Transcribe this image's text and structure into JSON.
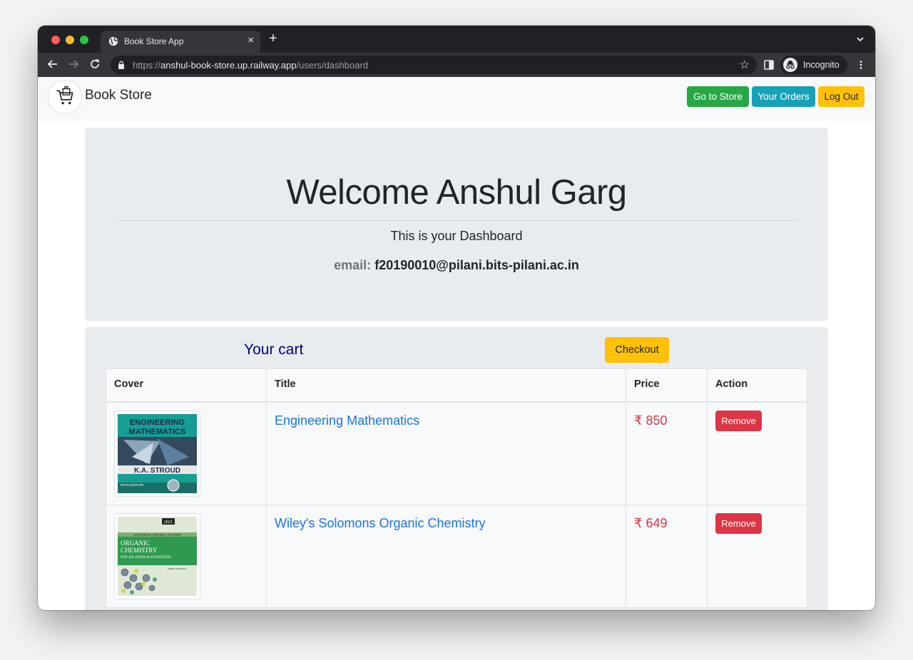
{
  "browser": {
    "tab_title": "Book Store App",
    "url_scheme": "https://",
    "url_host": "anshul-book-store.up.railway.app",
    "url_path": "/users/dashboard",
    "incognito_label": "Incognito"
  },
  "navbar": {
    "brand": "Book Store",
    "buttons": {
      "store": "Go to Store",
      "orders": "Your Orders",
      "logout": "Log Out"
    }
  },
  "dashboard": {
    "welcome_prefix": "Welcome",
    "user_name": "Anshul Garg",
    "subtitle": "This is your Dashboard",
    "email_label": "email:",
    "email_value": "f20190010@pilani.bits-pilani.ac.in"
  },
  "cart": {
    "title": "Your cart",
    "checkout_label": "Checkout",
    "columns": [
      "Cover",
      "Title",
      "Price",
      "Action"
    ],
    "items": [
      {
        "title": "Engineering Mathematics",
        "price": "₹ 850",
        "action": "Remove",
        "cover": {
          "line1": "ENGINEERING",
          "line2": "MATHEMATICS",
          "author": "K.A. STROUD",
          "edition": "FIFTH EDITION"
        }
      },
      {
        "title": "Wiley's Solomons Organic Chemistry",
        "price": "₹ 649",
        "action": "Remove",
        "cover": {
          "year": "2021",
          "authors": "SOLOMONS | FRYHLE | SNYDER",
          "line1": "ORGANIC",
          "line2": "CHEMISTRY",
          "line3": "FOR JEE (MAIN & ADVANCED)",
          "edition": "THIRD EDITION"
        }
      }
    ]
  },
  "colors": {
    "success": "#28a745",
    "info": "#17a2b8",
    "warning": "#ffc107",
    "danger": "#dc3545",
    "link": "#1a73e8",
    "cart_title": "#000080"
  },
  "icons": {
    "tab_favicon": "globe-icon",
    "logo": "shopping-cart-icon",
    "incognito": "incognito-icon"
  }
}
